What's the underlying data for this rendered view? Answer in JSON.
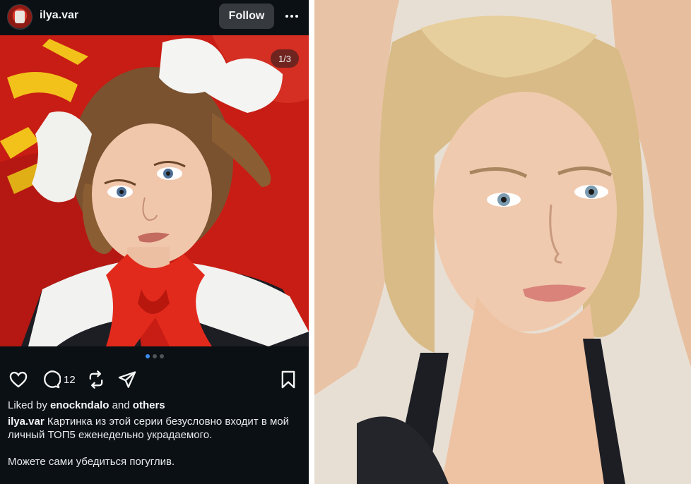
{
  "post": {
    "username": "ilya.var",
    "follow_label": "Follow",
    "more_icon": "more-horizontal-icon",
    "image_counter": "1/3",
    "carousel": {
      "total": 3,
      "active": 1
    },
    "actions": {
      "like_icon": "heart-icon",
      "comment_icon": "comment-icon",
      "comment_count": "12",
      "repost_icon": "repost-icon",
      "share_icon": "send-icon",
      "save_icon": "bookmark-icon"
    },
    "likes": {
      "prefix": "Liked by",
      "user": "enockndalo",
      "conjunction": "and",
      "others": "others"
    },
    "caption": {
      "author": "ilya.var",
      "text": "Картинка из этой серии безусловно входит в мой личный ТОП5 еженедельно украдаемого.",
      "text2": "Можете сами убедиться погуглив."
    }
  },
  "colors": {
    "post_bg": "#0b1014",
    "follow_bg": "#363a3f",
    "dot_active": "#3b8cf0",
    "flag_red": "#c41e14",
    "flag_yellow": "#f2c21b"
  }
}
